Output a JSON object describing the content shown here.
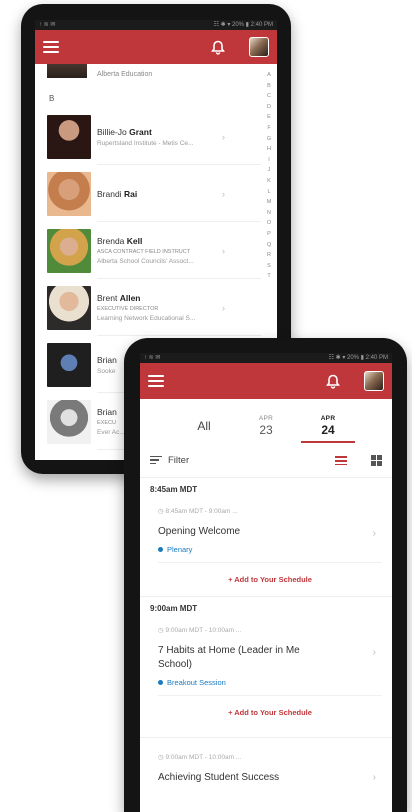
{
  "directory": {
    "status": {
      "left": "↑ ≋ ✉",
      "right": "☷ ✱ ▾ 20% ▮ 2:40 PM"
    },
    "first_row_org": "Alberta Education",
    "section_letter": "B",
    "index_letters": [
      "A",
      "B",
      "C",
      "D",
      "E",
      "F",
      "G",
      "H",
      "I",
      "J",
      "K",
      "L",
      "M",
      "N",
      "O",
      "P",
      "Q",
      "R",
      "S",
      "T"
    ],
    "people": [
      {
        "first": "Billie-Jo",
        "last": "Grant",
        "title": "",
        "org": "Rupertsland Institute - Metis Ce..."
      },
      {
        "first": "Brandi",
        "last": "Rai",
        "title": "",
        "org": ""
      },
      {
        "first": "Brenda",
        "last": "Kell",
        "title": "ASCA CONTRACT FIELD INSTRUCT",
        "org": "Alberta School Councils' Assoct..."
      },
      {
        "first": "Brent",
        "last": "Allen",
        "title": "EXECUTIVE DIRECTOR",
        "org": "Learning Network Educational S..."
      },
      {
        "first": "Brian",
        "last": "",
        "title": "",
        "org": "Sooke"
      },
      {
        "first": "Brian",
        "last": "",
        "title": "EXECU",
        "org": "Ever Ac..."
      }
    ]
  },
  "schedule": {
    "status": {
      "left": "↑ ≋ ✉",
      "right": "☷ ✱ ▾ 20% ▮ 2:40 PM"
    },
    "days": {
      "all_label": "All",
      "day1": {
        "month": "APR",
        "num": "23"
      },
      "day2": {
        "month": "APR",
        "num": "24"
      }
    },
    "filter_label": "Filter",
    "add_label": "+ Add to Your Schedule",
    "groups": [
      {
        "time": "8:45am MDT",
        "session": {
          "range": "8:45am MDT - 9:00am ...",
          "title": "Opening Welcome",
          "tag": "Plenary"
        }
      },
      {
        "time": "9:00am MDT",
        "session": {
          "range": "9:00am MDT - 10:00am ...",
          "title": "7 Habits at Home (Leader in Me School)",
          "tag": "Breakout Session"
        }
      }
    ],
    "third_session": {
      "range": "9:00am MDT - 10:00am ...",
      "title": "Achieving Student Success"
    }
  },
  "colors": {
    "accent": "#c0373b",
    "tag": "#1a7bc0"
  }
}
